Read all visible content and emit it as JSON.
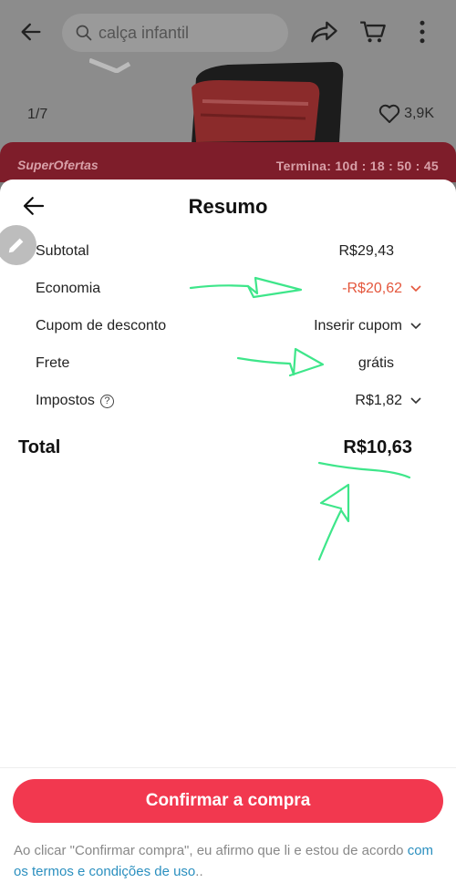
{
  "background_page": {
    "search_placeholder": "calça infantil",
    "image_counter": "1/7",
    "likes": "3,9K",
    "promo": {
      "title": "SuperOfertas",
      "timer": "Termina: 10d : 18 : 50 : 45"
    }
  },
  "sheet": {
    "title": "Resumo",
    "rows": [
      {
        "label": "Subtotal",
        "value": "R$29,43"
      },
      {
        "label": "Economia",
        "value": "-R$20,62"
      },
      {
        "label": "Cupom de desconto",
        "value": "Inserir cupom"
      },
      {
        "label": "Frete",
        "value": "grátis"
      },
      {
        "label": "Impostos",
        "value": "R$1,82"
      }
    ],
    "total": {
      "label": "Total",
      "value": "R$10,63"
    }
  },
  "footer": {
    "confirm_label": "Confirmar a compra",
    "disclaimer_text": "Ao clicar \"Confirmar compra\", eu afirmo que li e estou de acordo ",
    "terms_link": "com os termos e condições de uso",
    "disclaimer_end": ".."
  },
  "colors": {
    "accent": "#f2384f",
    "savings": "#e4573d",
    "annotation": "#3ee68a",
    "link": "#2a8fbf"
  }
}
